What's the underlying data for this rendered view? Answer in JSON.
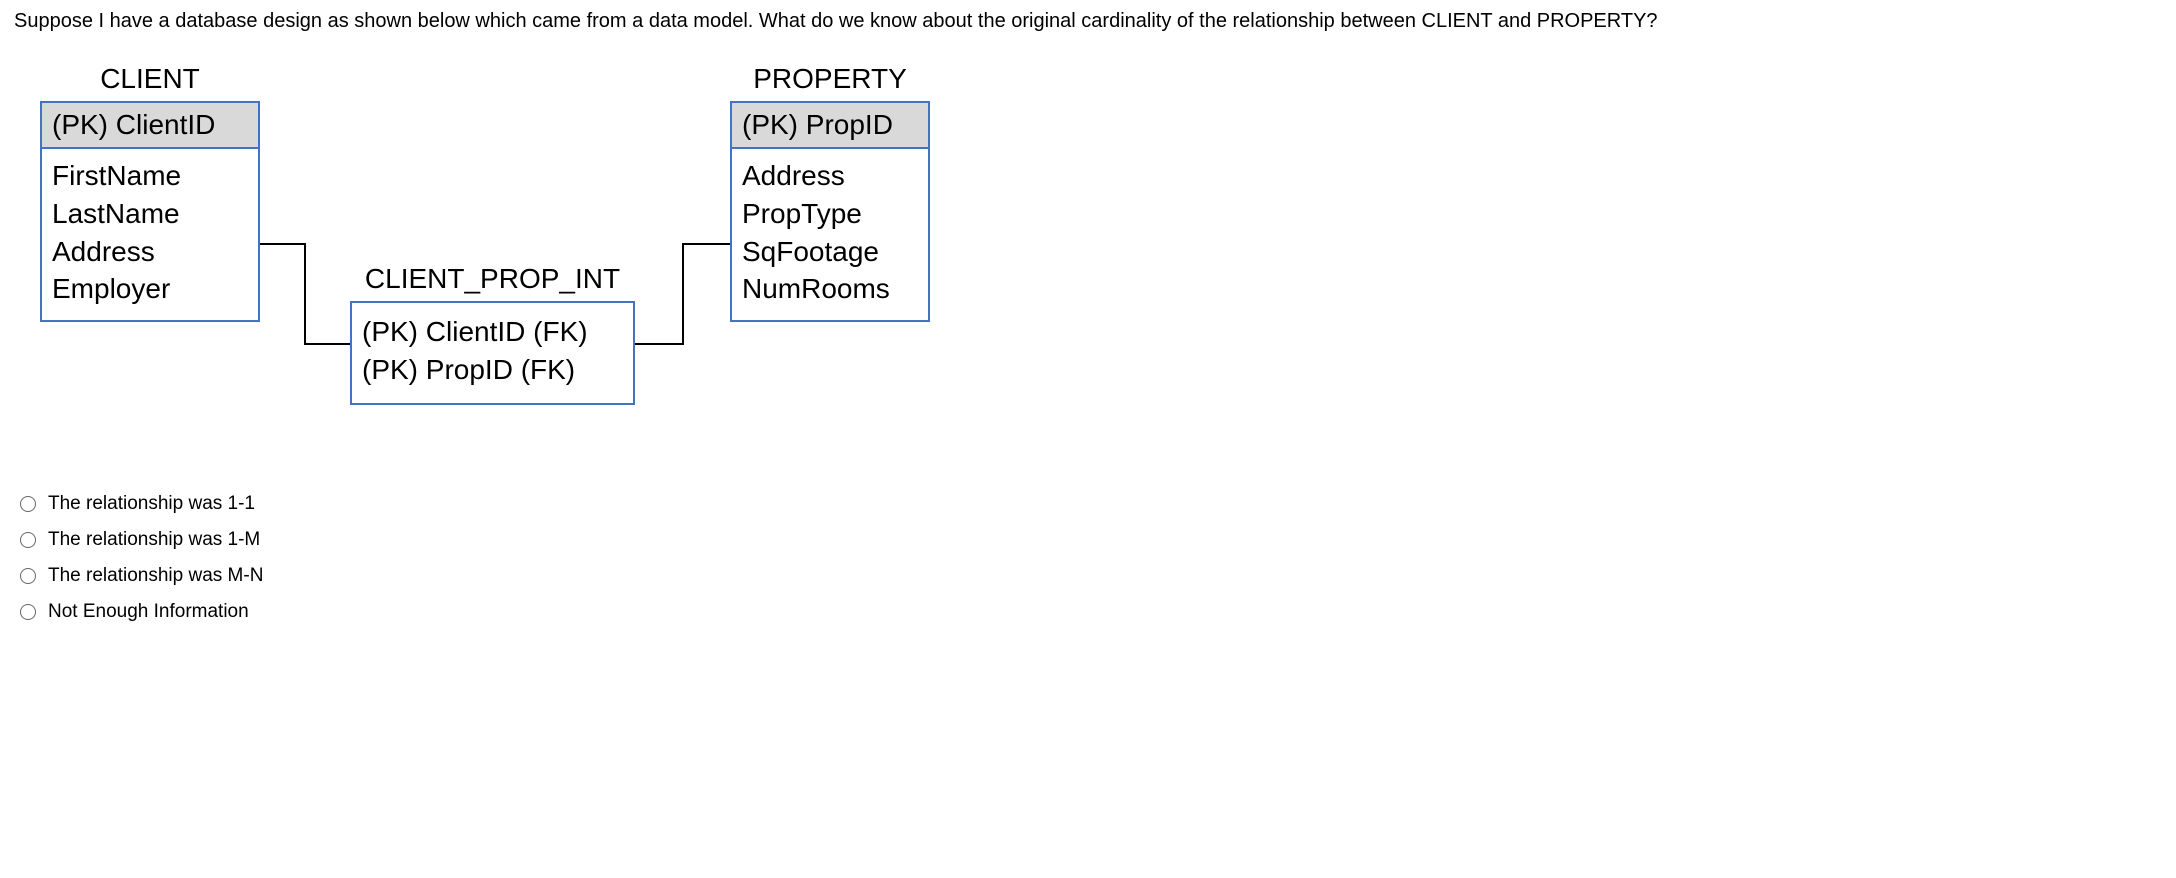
{
  "question": "Suppose I have a database design as shown below which came from a data model. What do we know about the original cardinality of the relationship between CLIENT and PROPERTY?",
  "entities": {
    "client": {
      "title": "CLIENT",
      "pk": "(PK) ClientID",
      "attrs": [
        "FirstName",
        "LastName",
        "Address",
        "Employer"
      ]
    },
    "property": {
      "title": "PROPERTY",
      "pk": "(PK) PropID",
      "attrs": [
        "Address",
        "PropType",
        "SqFootage",
        "NumRooms"
      ]
    },
    "junction": {
      "title": "CLIENT_PROP_INT",
      "attrs": [
        "(PK) ClientID (FK)",
        "(PK) PropID (FK)"
      ]
    }
  },
  "options": [
    "The relationship was 1-1",
    "The relationship was 1-M",
    "The relationship was M-N",
    "Not Enough Information"
  ]
}
